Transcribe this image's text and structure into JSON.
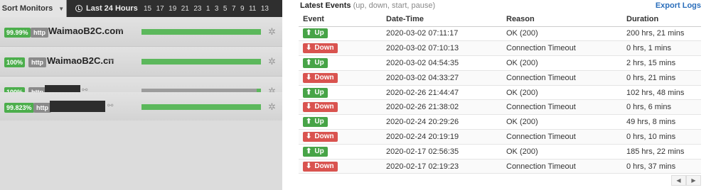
{
  "left": {
    "sort_label": "Sort Monitors",
    "range_label": "Last 24 Hours",
    "hours": [
      "15",
      "17",
      "19",
      "21",
      "23",
      "1",
      "3",
      "5",
      "7",
      "9",
      "11",
      "13"
    ],
    "monitors": [
      {
        "uptime": "99.99%",
        "type": "http",
        "name": "WaimaoB2C.com",
        "status": "up"
      },
      {
        "uptime": "100%",
        "type": "http",
        "name": "WaimaoB2C.cn",
        "status": "up"
      },
      {
        "uptime": "100%",
        "type": "http",
        "name": "",
        "status": "paused"
      },
      {
        "uptime": "99.823%",
        "type": "http",
        "name": "",
        "status": "up"
      }
    ]
  },
  "right": {
    "title": "Latest Events",
    "subtitle": "(up, down, start, pause)",
    "export_label": "Export Logs",
    "columns": [
      "Event",
      "Date-Time",
      "Reason",
      "Duration"
    ],
    "events": [
      {
        "event": "Up",
        "datetime": "2020-03-02 07:11:17",
        "reason": "OK (200)",
        "duration": "200 hrs, 21 mins"
      },
      {
        "event": "Down",
        "datetime": "2020-03-02 07:10:13",
        "reason": "Connection Timeout",
        "duration": "0 hrs, 1 mins"
      },
      {
        "event": "Up",
        "datetime": "2020-03-02 04:54:35",
        "reason": "OK (200)",
        "duration": "2 hrs, 15 mins"
      },
      {
        "event": "Down",
        "datetime": "2020-03-02 04:33:27",
        "reason": "Connection Timeout",
        "duration": "0 hrs, 21 mins"
      },
      {
        "event": "Up",
        "datetime": "2020-02-26 21:44:47",
        "reason": "OK (200)",
        "duration": "102 hrs, 48 mins"
      },
      {
        "event": "Down",
        "datetime": "2020-02-26 21:38:02",
        "reason": "Connection Timeout",
        "duration": "0 hrs, 6 mins"
      },
      {
        "event": "Up",
        "datetime": "2020-02-24 20:29:26",
        "reason": "OK (200)",
        "duration": "49 hrs, 8 mins"
      },
      {
        "event": "Down",
        "datetime": "2020-02-24 20:19:19",
        "reason": "Connection Timeout",
        "duration": "0 hrs, 10 mins"
      },
      {
        "event": "Up",
        "datetime": "2020-02-17 02:56:35",
        "reason": "OK (200)",
        "duration": "185 hrs, 22 mins"
      },
      {
        "event": "Down",
        "datetime": "2020-02-17 02:19:23",
        "reason": "Connection Timeout",
        "duration": "0 hrs, 37 mins"
      }
    ],
    "pager": {
      "prev": "◀",
      "next": "▶"
    }
  },
  "colors": {
    "up": "#47a447",
    "down": "#d9534f",
    "link": "#2a6ebb"
  }
}
